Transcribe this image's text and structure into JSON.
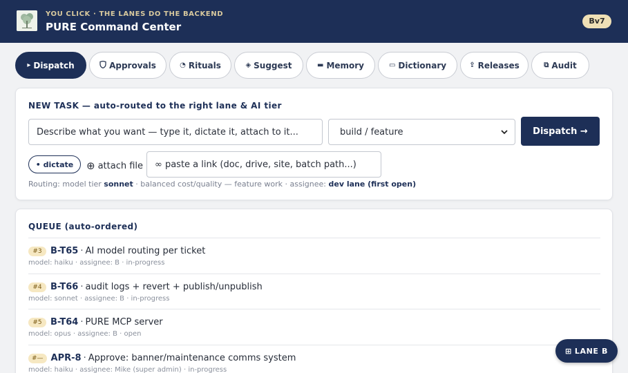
{
  "header": {
    "kicker": "YOU CLICK · THE LANES DO THE BACKEND",
    "title": "PURE Command Center",
    "version_badge": "Bv7",
    "logo_icon": "tree-logo"
  },
  "tabs": [
    {
      "icon": "▸",
      "label": "Dispatch",
      "active": true
    },
    {
      "icon": "🛡",
      "label": "Approvals"
    },
    {
      "icon": "◔",
      "label": "Rituals"
    },
    {
      "icon": "◈",
      "label": "Suggest"
    },
    {
      "icon": "▬",
      "label": "Memory"
    },
    {
      "icon": "▭",
      "label": "Dictionary"
    },
    {
      "icon": "⇪",
      "label": "Releases"
    },
    {
      "icon": "⧉",
      "label": "Audit"
    }
  ],
  "new_task": {
    "heading": "NEW TASK — auto-routed to the right lane & AI tier",
    "input_placeholder": "Describe what you want — type it, dictate it, attach to it...",
    "type_select": "build / feature",
    "dispatch_label": "Dispatch →",
    "dictate_label": "• dictate",
    "attach_icon": "⊕",
    "attach_label": "attach file",
    "link_placeholder": "∞ paste a link (doc, drive, site, batch path...)",
    "routing": {
      "prefix": "Routing: model tier ",
      "tier": "sonnet",
      "middle": " · balanced cost/quality — feature work · assignee: ",
      "assignee": "dev lane (first open)"
    }
  },
  "queue": {
    "heading": "QUEUE (auto-ordered)",
    "items": [
      {
        "priority": "#3",
        "id": "B-T65",
        "title": "AI model routing per ticket",
        "meta": "model: haiku · assignee: B · in-progress"
      },
      {
        "priority": "#4",
        "id": "B-T66",
        "title": "audit logs + revert + publish/unpublish",
        "meta": "model: sonnet · assignee: B · in-progress"
      },
      {
        "priority": "#5",
        "id": "B-T64",
        "title": "PURE MCP server",
        "meta": "model: opus · assignee: B · open"
      },
      {
        "priority": "#—",
        "id": "APR-8",
        "title": "Approve: banner/maintenance comms system",
        "meta": "model: haiku · assignee: Mike (super admin) · in-progress"
      }
    ]
  },
  "lane_button": {
    "icon": "⊞",
    "label": "LANE B"
  },
  "colors": {
    "navy": "#1d2f57",
    "gold": "#efe0b6",
    "background": "#f1f2f4"
  }
}
